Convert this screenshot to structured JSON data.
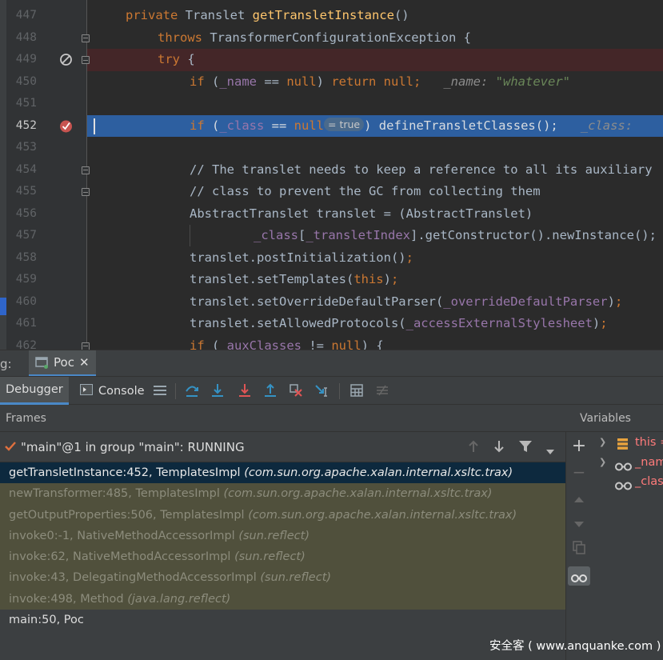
{
  "editor": {
    "lines": [
      {
        "num": "447",
        "type": "normal"
      },
      {
        "num": "448",
        "type": "normal"
      },
      {
        "num": "449",
        "type": "error"
      },
      {
        "num": "450",
        "type": "normal"
      },
      {
        "num": "451",
        "type": "normal"
      },
      {
        "num": "452",
        "type": "current"
      },
      {
        "num": "453",
        "type": "normal"
      },
      {
        "num": "454",
        "type": "normal"
      },
      {
        "num": "455",
        "type": "normal"
      },
      {
        "num": "456",
        "type": "normal"
      },
      {
        "num": "457",
        "type": "normal"
      },
      {
        "num": "458",
        "type": "normal"
      },
      {
        "num": "459",
        "type": "normal"
      },
      {
        "num": "460",
        "type": "normal"
      },
      {
        "num": "461",
        "type": "normal"
      },
      {
        "num": "462",
        "type": "normal"
      }
    ],
    "code": {
      "l447_kw": "private ",
      "l447_type": "Translet ",
      "l447_fn": "getTransletInstance",
      "l447_rest": "()",
      "l448_kw": "throws ",
      "l448_rest": "TransformerConfigurationException {",
      "l449_kw": "try ",
      "l449_rest": "{",
      "l450_if": "if ",
      "l450_p1": "(",
      "l450_fld": "_name",
      "l450_p2": " == ",
      "l450_null": "null",
      "l450_p3": ") ",
      "l450_ret": "return ",
      "l450_null2": "null",
      "l450_semi": ";",
      "l450_hint": "_name: ",
      "l450_hint_val": "\"whatever\"",
      "l452_if": "if ",
      "l452_p1": "(",
      "l452_fld": "_class",
      "l452_p2": " == ",
      "l452_null": "null",
      "l452_badge": "= true",
      "l452_p3": ") ",
      "l452_fn": "defineTransletClasses",
      "l452_p4": "();",
      "l452_hint": "_class:",
      "l454_cmt": "// The translet needs to keep a reference to all its auxiliary",
      "l455_cmt": "// class to prevent the GC from collecting them",
      "l456_text": "AbstractTranslet translet = (AbstractTranslet)",
      "l457_fld": "_class",
      "l457_p1": "[",
      "l457_fld2": "_transletIndex",
      "l457_p2": "].getConstructor().newInstance();",
      "l458_text": "translet.postInitialization()",
      "l458_semi": ";",
      "l459_text": "translet.setTemplates(",
      "l459_kw": "this",
      "l459_end": ")",
      "l459_semi": ";",
      "l460_text": "translet.setOverrideDefaultParser(",
      "l460_fld": "_overrideDefaultParser",
      "l460_end": ")",
      "l460_semi": ";",
      "l461_text": "translet.setAllowedProtocols(",
      "l461_fld": "_accessExternalStylesheet",
      "l461_end": ")",
      "l461_semi": ";",
      "l462_if": "if ",
      "l462_p1": "(",
      "l462_fld": "_auxClasses",
      "l462_p2": " != ",
      "l462_null": "null",
      "l462_p3": ") {"
    }
  },
  "debug": {
    "panel_label": "g:",
    "session_tab": "Poc",
    "tabs": {
      "debugger": "Debugger",
      "console": "Console"
    },
    "frames_header": "Frames",
    "variables_header": "Variables",
    "thread": "\"main\"@1 in group \"main\": RUNNING",
    "frames": [
      {
        "method": "getTransletInstance:452, TemplatesImpl ",
        "pkg": "(com.sun.org.apache.xalan.internal.xsltc.trax)",
        "style": "sel"
      },
      {
        "method": "newTransformer:485, TemplatesImpl ",
        "pkg": "(com.sun.org.apache.xalan.internal.xsltc.trax)",
        "style": "lib"
      },
      {
        "method": "getOutputProperties:506, TemplatesImpl ",
        "pkg": "(com.sun.org.apache.xalan.internal.xsltc.trax)",
        "style": "lib"
      },
      {
        "method": "invoke0:-1, NativeMethodAccessorImpl ",
        "pkg": "(sun.reflect)",
        "style": "lib"
      },
      {
        "method": "invoke:62, NativeMethodAccessorImpl ",
        "pkg": "(sun.reflect)",
        "style": "lib"
      },
      {
        "method": "invoke:43, DelegatingMethodAccessorImpl ",
        "pkg": "(sun.reflect)",
        "style": "lib"
      },
      {
        "method": "invoke:498, Method ",
        "pkg": "(java.lang.reflect)",
        "style": "lib"
      },
      {
        "method": "main:50, Poc",
        "pkg": "",
        "style": "norm"
      }
    ],
    "variables": [
      {
        "name": "this =",
        "icon": "field-list-icon"
      },
      {
        "name": "_name",
        "icon": "watch-glasses-icon"
      },
      {
        "name": "_class",
        "icon": "watch-glasses-icon"
      }
    ]
  },
  "watermark": "安全客 ( www.anquanke.com )"
}
